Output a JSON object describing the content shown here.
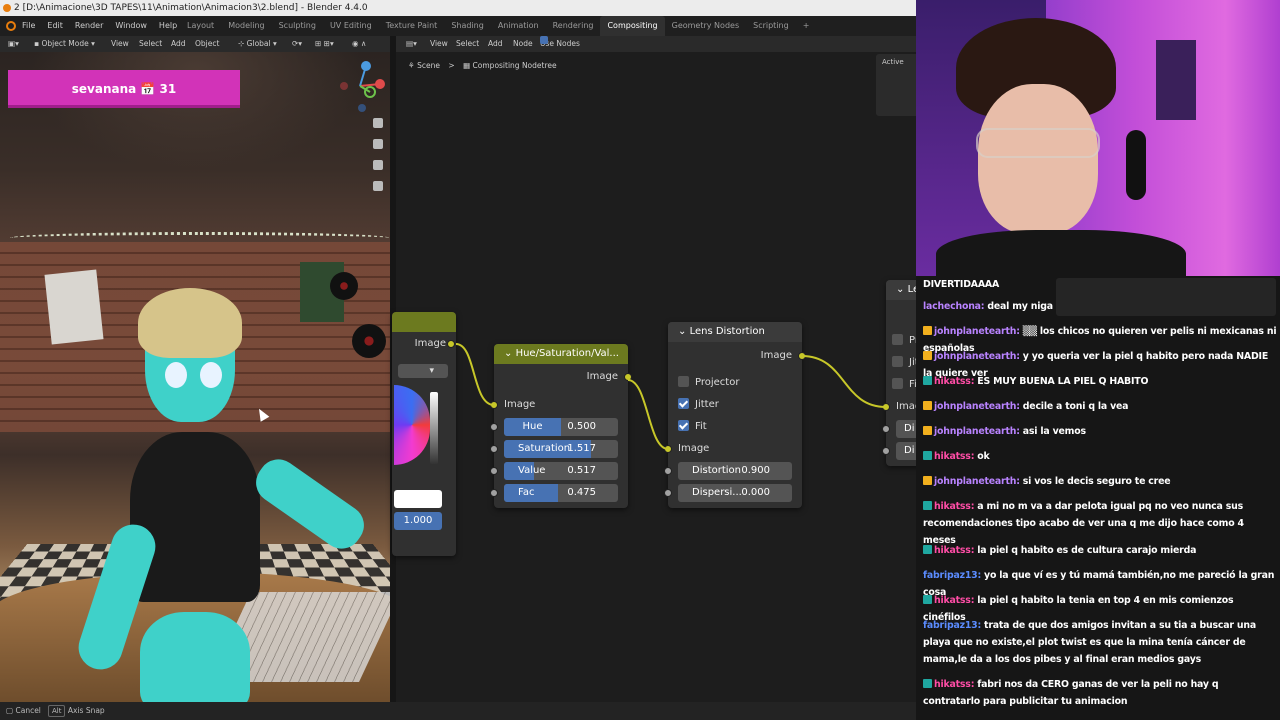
{
  "window": {
    "title": "2 [D:\\Animacione\\3D TAPES\\11\\Animation\\Animacion3\\2.blend] - Blender 4.4.0"
  },
  "menu": {
    "items": [
      "File",
      "Edit",
      "Render",
      "Window",
      "Help"
    ]
  },
  "workspaces": {
    "tabs": [
      "Layout",
      "Modeling",
      "Sculpting",
      "UV Editing",
      "Texture Paint",
      "Shading",
      "Animation",
      "Rendering",
      "Compositing",
      "Geometry Nodes",
      "Scripting"
    ],
    "active": "Compositing",
    "add_icon": "+"
  },
  "viewport_header": {
    "mode": "Object Mode",
    "view": "View",
    "select": "Select",
    "add": "Add",
    "object": "Object",
    "orientation": "Global"
  },
  "overlay_banner": {
    "text": "sevanana 📅 31",
    "color": "#d233b8"
  },
  "node_header": {
    "view": "View",
    "select": "Select",
    "add": "Add",
    "node": "Node",
    "use_nodes": "Use Nodes"
  },
  "breadcrumb": {
    "scene": "Scene",
    "separator": ">",
    "tree": "Compositing Nodetree"
  },
  "active_panel": {
    "label": "Active"
  },
  "nodes": {
    "partial_left": {
      "output": "Image",
      "value": "1.000"
    },
    "hsv": {
      "title": "Hue/Saturation/Val...",
      "output": "Image",
      "input": "Image",
      "header_color": "#6c7a1f",
      "fields": [
        {
          "label": "Hue",
          "value": "0.500",
          "fill": 0.5
        },
        {
          "label": "Saturation",
          "value": "1.517",
          "fill": 0.758
        },
        {
          "label": "Value",
          "value": "0.517",
          "fill": 0.26
        },
        {
          "label": "Fac",
          "value": "0.475",
          "fill": 0.475
        }
      ]
    },
    "lens": {
      "title": "Lens Distortion",
      "output": "Image",
      "input": "Image",
      "header_color": "#3b3b3b",
      "projector": "Projector",
      "jitter": "Jitter",
      "fit": "Fit",
      "distortion_label": "Distortion",
      "distortion_value": "0.900",
      "dispersion_label": "Dispersi...",
      "dispersion_value": "0.000"
    },
    "partial_right": {
      "title": "Le",
      "r1": "Pr",
      "r2": "Jit",
      "r3": "Fit",
      "input": "Imag",
      "f1": "Di",
      "f2": "Di"
    }
  },
  "statusbar": {
    "cancel": "Cancel",
    "key": "Alt",
    "axis_snap": "Axis Snap"
  },
  "chat": {
    "messages": [
      {
        "user": "",
        "text": "DIVERTIDAAAA",
        "user_color": "#ffffff",
        "badge": ""
      },
      {
        "user": "lachechona:",
        "text": "deal my niga",
        "user_color": "#b983ff",
        "badge": ""
      },
      {
        "user": "johnplanetearth:",
        "text": "▒▒ los chicos no quieren ver pelis ni mexicanas ni españolas",
        "user_color": "#b983ff",
        "badge": "gold"
      },
      {
        "user": "johnplanetearth:",
        "text": "y yo queria ver la piel q habito pero nada NADIE la quiere ver",
        "user_color": "#b983ff",
        "badge": "gold"
      },
      {
        "user": "hikatss:",
        "text": "ES MUY BUENA LA PIEL Q HABITO",
        "user_color": "#ff4da6",
        "badge": "teal"
      },
      {
        "user": "johnplanetearth:",
        "text": "decile a toni q la vea",
        "user_color": "#b983ff",
        "badge": "gold"
      },
      {
        "user": "johnplanetearth:",
        "text": "asi la vemos",
        "user_color": "#b983ff",
        "badge": "gold"
      },
      {
        "user": "hikatss:",
        "text": "ok",
        "user_color": "#ff4da6",
        "badge": "teal"
      },
      {
        "user": "johnplanetearth:",
        "text": "si vos le decis seguro te cree",
        "user_color": "#b983ff",
        "badge": "gold"
      },
      {
        "user": "hikatss:",
        "text": "a mi no m va a dar pelota igual pq no veo nunca sus recomendaciones tipo acabo de ver una q me dijo hace como 4 meses",
        "user_color": "#ff4da6",
        "badge": "teal"
      },
      {
        "user": "hikatss:",
        "text": "la piel q habito es de cultura carajo mierda",
        "user_color": "#ff4da6",
        "badge": "teal"
      },
      {
        "user": "fabripaz13:",
        "text": "yo la que ví es y tú mamá también,no me pareció la gran cosa",
        "user_color": "#5b8cff",
        "badge": ""
      },
      {
        "user": "hikatss:",
        "text": "la piel q habito la tenia en top 4 en mis comienzos cinéfilos",
        "user_color": "#ff4da6",
        "badge": "teal"
      },
      {
        "user": "fabripaz13:",
        "text": "trata de que dos amigos invitan a su tia a buscar una playa que no existe,el plot twist es que la mina tenía cáncer de mama,le da a los dos pibes y al final eran medios gays",
        "user_color": "#5b8cff",
        "badge": ""
      },
      {
        "user": "hikatss:",
        "text": "fabri nos da CERO ganas de ver la peli no hay q contratarlo para publicitar tu animacion",
        "user_color": "#ff4da6",
        "badge": "teal"
      }
    ]
  }
}
